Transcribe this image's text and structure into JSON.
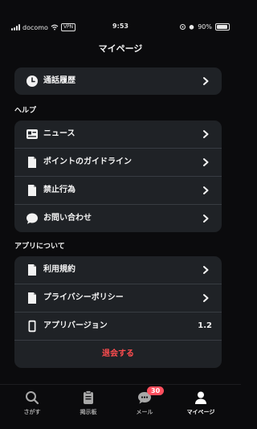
{
  "status_bar": {
    "carrier": "docomo",
    "vpn": "VPN",
    "time": "9:53",
    "battery": "90%",
    "battery_level": 0.9
  },
  "header": {
    "title": "マイページ"
  },
  "history": {
    "label": "通話履歴"
  },
  "help": {
    "title": "ヘルプ",
    "items": [
      {
        "label": "ニュース",
        "icon": "news-icon"
      },
      {
        "label": "ポイントのガイドライン",
        "icon": "document-icon"
      },
      {
        "label": "禁止行為",
        "icon": "document-icon"
      },
      {
        "label": "お問い合わせ",
        "icon": "chat-bubble-icon"
      }
    ]
  },
  "about": {
    "title": "アプリについて",
    "items": [
      {
        "label": "利用規約",
        "icon": "document-icon"
      },
      {
        "label": "プライバシーポリシー",
        "icon": "document-icon"
      },
      {
        "label": "アプリバージョン",
        "icon": "phone-icon",
        "value": "1.2"
      }
    ],
    "withdraw_label": "退会する"
  },
  "tabs": [
    {
      "label": "さがす",
      "icon": "search-icon"
    },
    {
      "label": "掲示板",
      "icon": "board-icon"
    },
    {
      "label": "メール",
      "icon": "mail-icon",
      "badge": "30"
    },
    {
      "label": "マイページ",
      "icon": "person-icon",
      "active": true
    }
  ],
  "colors": {
    "background": "#0b0b0d",
    "card": "#1f2226",
    "danger": "#ff4d4f",
    "badge": "#ff4f5e"
  }
}
